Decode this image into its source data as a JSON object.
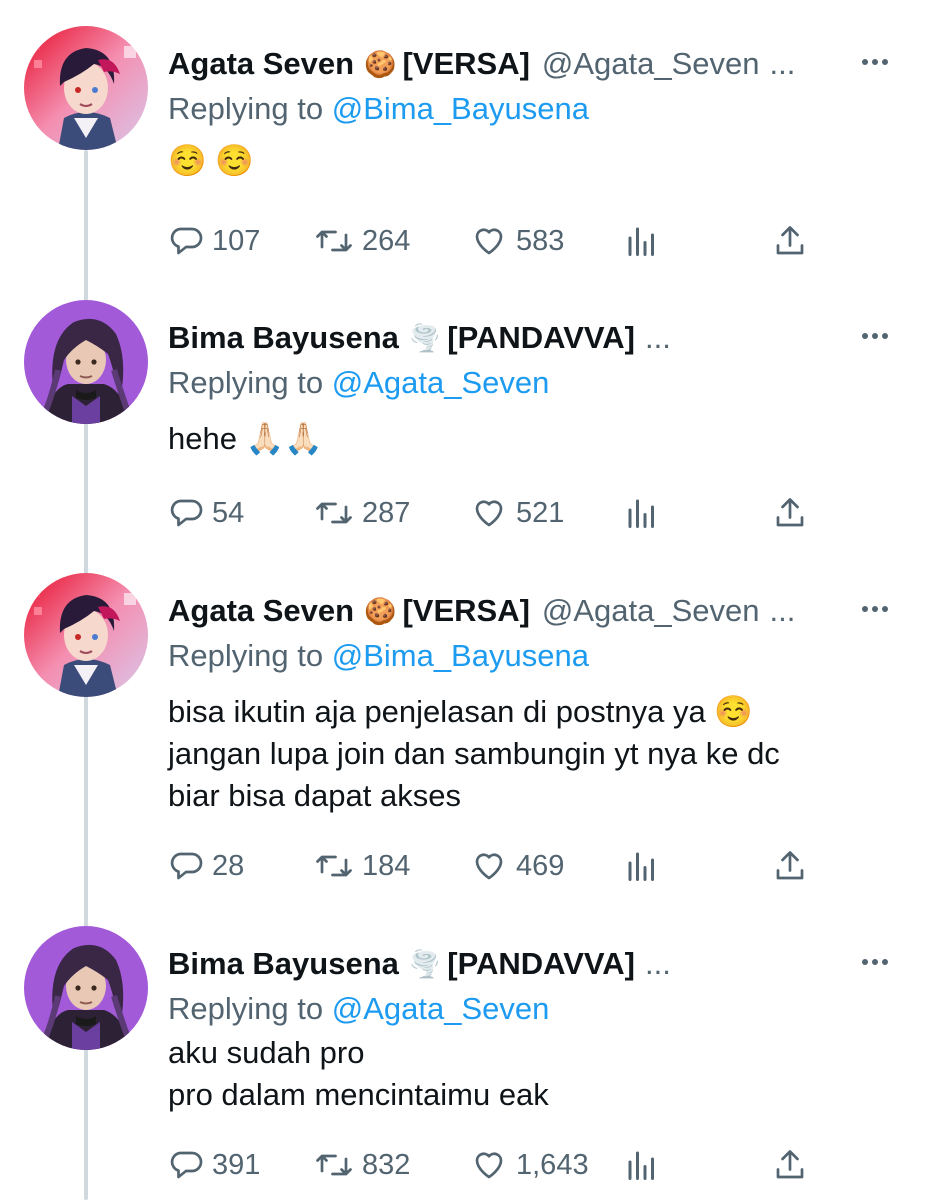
{
  "tweets": [
    {
      "name": "Agata Seven",
      "name_emoji": "🍪",
      "tag": "[VERSA]",
      "handle": "@Agata_Seven",
      "ellipsis": "...",
      "replying_prefix": "Replying to",
      "replying_to": "@Bima_Bayusena",
      "body_lines": [
        "☺️ ☺️"
      ],
      "stats": {
        "replies": "107",
        "retweets": "264",
        "likes": "583"
      },
      "avatar_icon": "avatar-agata-icon"
    },
    {
      "name": "Bima Bayusena",
      "name_emoji": "🌪️",
      "tag": "[PANDAVVA]",
      "handle": "",
      "ellipsis": "...",
      "replying_prefix": "Replying to",
      "replying_to": "@Agata_Seven",
      "body_lines": [
        "hehe 🙏🏻🙏🏻"
      ],
      "stats": {
        "replies": "54",
        "retweets": "287",
        "likes": "521"
      },
      "avatar_icon": "avatar-bima-icon"
    },
    {
      "name": "Agata Seven",
      "name_emoji": "🍪",
      "tag": "[VERSA]",
      "handle": "@Agata_Seven",
      "ellipsis": "...",
      "replying_prefix": "Replying to",
      "replying_to": "@Bima_Bayusena",
      "body_lines": [
        "bisa ikutin aja penjelasan di postnya ya ☺️",
        "jangan lupa join dan sambungin yt nya ke dc",
        "biar bisa dapat akses"
      ],
      "stats": {
        "replies": "28",
        "retweets": "184",
        "likes": "469"
      },
      "avatar_icon": "avatar-agata-icon"
    },
    {
      "name": "Bima Bayusena",
      "name_emoji": "🌪️",
      "tag": "[PANDAVVA]",
      "handle": "",
      "ellipsis": "...",
      "replying_prefix": "Replying to",
      "replying_to": "@Agata_Seven",
      "body_lines": [
        "aku sudah pro",
        "pro dalam mencintaimu eak"
      ],
      "stats": {
        "replies": "391",
        "retweets": "832",
        "likes": "1,643"
      },
      "avatar_icon": "avatar-bima-icon"
    }
  ],
  "icons": {
    "reply": "reply-icon",
    "retweet": "retweet-icon",
    "like": "like-icon",
    "views": "views-icon",
    "share": "share-icon",
    "more": "more-icon"
  },
  "colors": {
    "text": "#0f1419",
    "secondary": "#536471",
    "link": "#1d9bf0",
    "thread_line": "#cfd9de"
  }
}
